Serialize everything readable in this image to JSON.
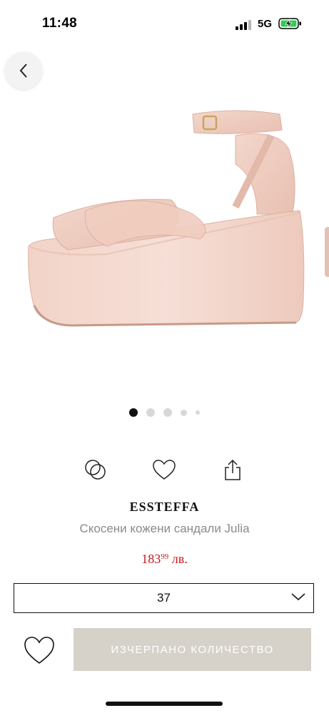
{
  "status_bar": {
    "time": "11:48",
    "network": "5G"
  },
  "gallery": {
    "image_description_icon": "platform-wedge-sandal-image",
    "active_index": 0,
    "dot_count": 5
  },
  "actions": {
    "compare_icon": "compare-rings-icon",
    "wishlist_icon": "heart-icon",
    "share_icon": "share-icon"
  },
  "product": {
    "brand": "ESSTEFFA",
    "name": "Скосени кожени сандали Julia",
    "price_main": "183",
    "price_cents": "99",
    "currency": " лв.",
    "price_color": "#c4191d"
  },
  "size": {
    "selected": "37"
  },
  "cta": {
    "label": "ИЗЧЕРПАНО КОЛИЧЕСТВО",
    "color": "#d6d2ca"
  }
}
